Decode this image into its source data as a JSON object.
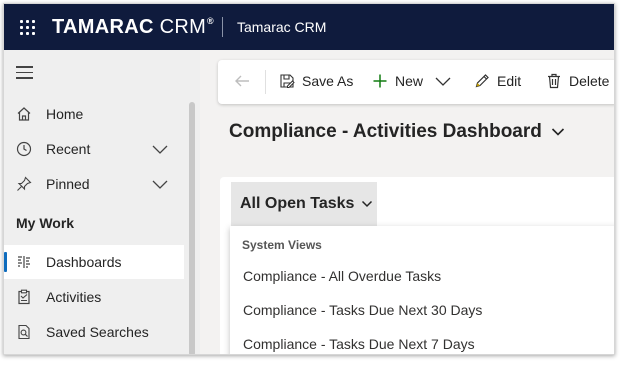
{
  "topbar": {
    "brand_main": "TAMARAC",
    "brand_light": "CRM",
    "brand_reg": "®",
    "app_title": "Tamarac CRM",
    "bg_color": "#0f1b3d"
  },
  "sidebar": {
    "items": [
      {
        "label": "Home",
        "icon": "home-icon"
      },
      {
        "label": "Recent",
        "icon": "clock-icon"
      },
      {
        "label": "Pinned",
        "icon": "pin-icon"
      }
    ],
    "section_title": "My Work",
    "work_items": [
      {
        "label": "Dashboards",
        "icon": "dashboard-icon",
        "selected": true
      },
      {
        "label": "Activities",
        "icon": "clipboard-icon"
      },
      {
        "label": "Saved Searches",
        "icon": "saved-search-icon"
      }
    ],
    "selected_accent": "#0f6cbd"
  },
  "commandbar": {
    "save_as": "Save As",
    "new": "New",
    "edit": "Edit",
    "delete": "Delete"
  },
  "page": {
    "title": "Compliance - Activities Dashboard"
  },
  "view_selector": {
    "current": "All Open Tasks",
    "group_heading": "System Views",
    "options": [
      "Compliance - All Overdue Tasks",
      "Compliance - Tasks Due Next 30 Days",
      "Compliance - Tasks Due Next 7 Days"
    ]
  }
}
